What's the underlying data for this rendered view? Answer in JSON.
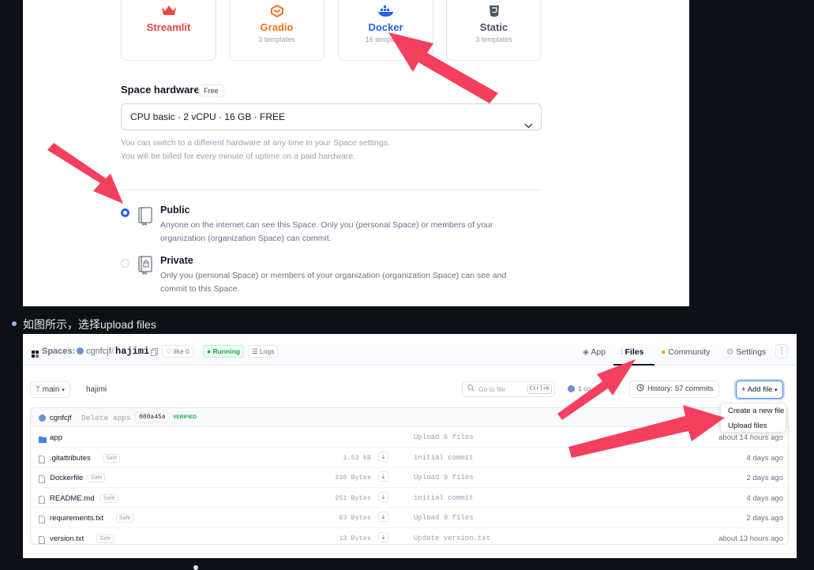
{
  "templates": [
    {
      "name": "Streamlit",
      "count": "",
      "color": "#ef4444",
      "icon": "crown-icon"
    },
    {
      "name": "Gradio",
      "count": "3 templates",
      "color": "#f97316",
      "icon": "gradio-logo-icon"
    },
    {
      "name": "Docker",
      "count": "16 templates",
      "color": "#2563eb",
      "icon": "docker-whale-icon"
    },
    {
      "name": "Static",
      "count": "3 templates",
      "color": "#4b5563",
      "icon": "html5-icon"
    }
  ],
  "hardware": {
    "title": "Space hardware",
    "badge": "Free",
    "selected": "CPU basic · 2 vCPU · 16 GB · FREE",
    "note_line1": "You can switch to a different hardware at any time in your Space settings.",
    "note_line2": "You will be billed for every minute of uptime on a paid hardware."
  },
  "visibility": {
    "public_title": "Public",
    "public_desc": "Anyone on the internet can see this Space. Only you (personal Space) or members of your organization (organization Space) can commit.",
    "private_title": "Private",
    "private_desc": "Only you (personal Space) or members of your organization (organization Space) can see and commit to this Space.",
    "selected": "public"
  },
  "bullet_text": "如图所示，选择upload files",
  "space_header": {
    "spaces_label": "Spaces:",
    "owner": "cgnfcjf",
    "separator": "/",
    "repo": "hajimi",
    "like_label": "like",
    "like_count": "0",
    "status": "Running",
    "logs_label": "Logs",
    "nav": {
      "app": "App",
      "files": "Files",
      "community": "Community",
      "settings": "Settings"
    },
    "more": "⋮"
  },
  "toolbar": {
    "branch": "main",
    "breadcrumb": "hajimi",
    "goto_placeholder": "Go to file",
    "goto_kbd": "Ctrl+K",
    "contributors": "1 co",
    "history": "History: 57 commits",
    "add_file": "Add file"
  },
  "last_commit": {
    "author": "cgnfcjf",
    "message": "Delete apps",
    "hash": "080a45a",
    "verified": "VERIFIED"
  },
  "files": [
    {
      "name": "app",
      "type": "folder",
      "safe": "",
      "size": "",
      "commit": "Upload 6 files",
      "time": "about 14 hours ago"
    },
    {
      "name": ".gitattributes",
      "type": "file",
      "safe": "Safe",
      "size": "1.52 kB",
      "commit": "initial commit",
      "time": "4 days ago"
    },
    {
      "name": "Dockerfile",
      "type": "file",
      "safe": "Safe",
      "size": "330 Bytes",
      "commit": "Upload 9 files",
      "time": "2 days ago"
    },
    {
      "name": "README.md",
      "type": "file",
      "safe": "Safe",
      "size": "251 Bytes",
      "commit": "initial commit",
      "time": "4 days ago"
    },
    {
      "name": "requirements.txt",
      "type": "file",
      "safe": "Safe",
      "size": "63 Bytes",
      "commit": "Upload 9 files",
      "time": "2 days ago"
    },
    {
      "name": "version.txt",
      "type": "file",
      "safe": "Safe",
      "size": "13 Bytes",
      "commit": "Update version.txt",
      "time": "about 13 hours ago"
    }
  ],
  "add_file_menu": {
    "create": "Create a new file",
    "upload": "Upload files"
  },
  "colors": {
    "arrow": "#f43f5e",
    "accent": "#2563eb",
    "running": "#16a34a"
  }
}
